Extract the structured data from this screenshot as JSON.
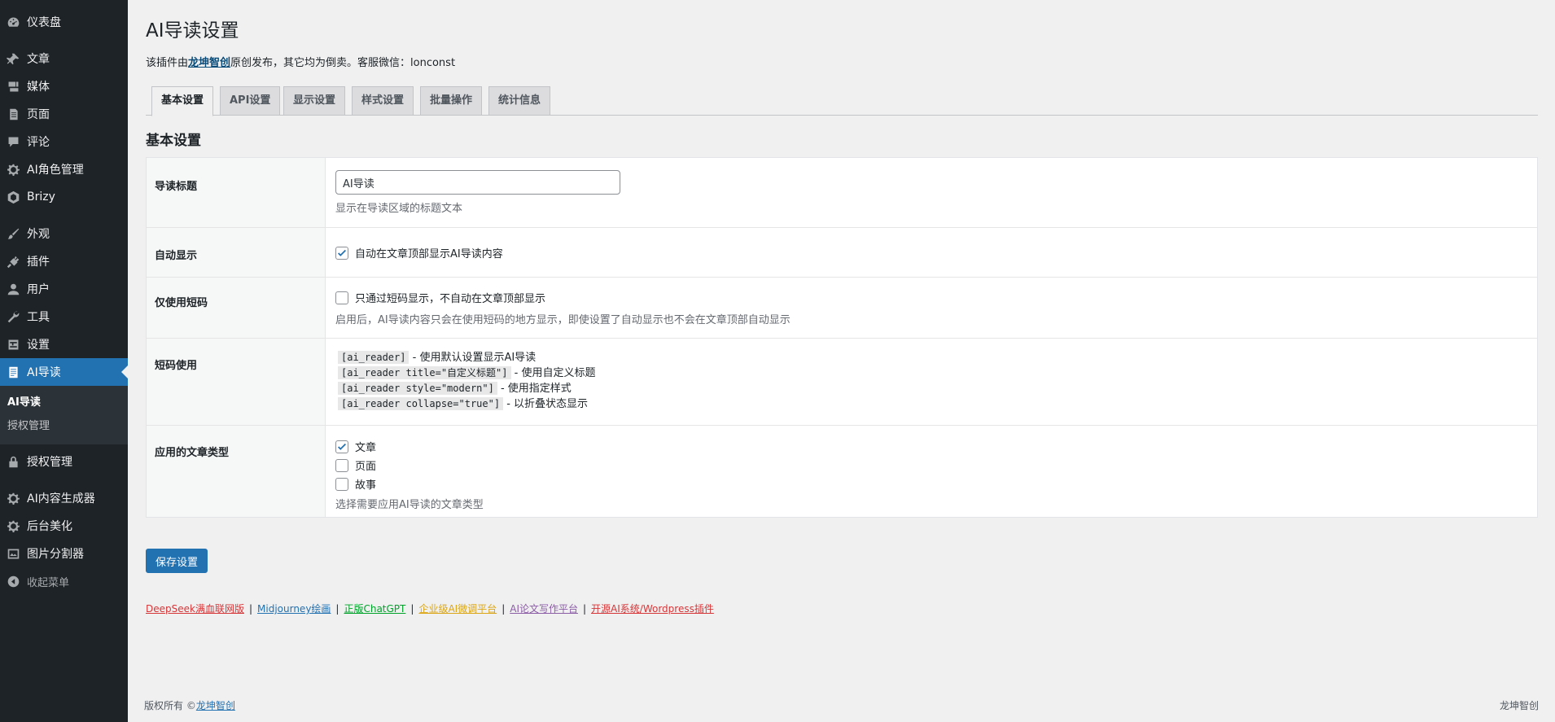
{
  "sidebar": {
    "items": [
      {
        "label": "仪表盘",
        "icon": "dashboard-icon"
      },
      {
        "label": "文章",
        "icon": "pushpin-icon"
      },
      {
        "label": "媒体",
        "icon": "media-icon"
      },
      {
        "label": "页面",
        "icon": "page-icon"
      },
      {
        "label": "评论",
        "icon": "comment-icon"
      },
      {
        "label": "AI角色管理",
        "icon": "gear-icon"
      },
      {
        "label": "Brizy",
        "icon": "brizy-icon"
      },
      {
        "label": "外观",
        "icon": "brush-icon"
      },
      {
        "label": "插件",
        "icon": "plugin-icon"
      },
      {
        "label": "用户",
        "icon": "user-icon"
      },
      {
        "label": "工具",
        "icon": "wrench-icon"
      },
      {
        "label": "设置",
        "icon": "settings-icon"
      },
      {
        "label": "AI导读",
        "icon": "document-icon"
      }
    ],
    "submenu": [
      {
        "label": "AI导读"
      },
      {
        "label": "授权管理"
      }
    ],
    "items2": [
      {
        "label": "授权管理",
        "icon": "lock-icon"
      },
      {
        "label": "AI内容生成器",
        "icon": "gear-icon"
      },
      {
        "label": "后台美化",
        "icon": "gear-icon"
      },
      {
        "label": "图片分割器",
        "icon": "image-icon"
      },
      {
        "label": "收起菜单",
        "icon": "collapse-icon"
      }
    ]
  },
  "page": {
    "title": "AI导读设置",
    "notice_prefix": "该插件由",
    "notice_link": "龙坤智创",
    "notice_suffix": "原创发布，其它均为倒卖。客服微信：lonconst"
  },
  "tabs": [
    {
      "label": "基本设置",
      "active": true
    },
    {
      "label": "API设置",
      "active": false
    },
    {
      "label": "显示设置",
      "active": false
    },
    {
      "label": "样式设置",
      "active": false
    },
    {
      "label": "批量操作",
      "active": false
    },
    {
      "label": "统计信息",
      "active": false
    }
  ],
  "section_title": "基本设置",
  "form": {
    "title_row": {
      "label": "导读标题",
      "value": "AI导读",
      "desc": "显示在导读区域的标题文本"
    },
    "auto_row": {
      "label": "自动显示",
      "checkbox_label": "自动在文章顶部显示AI导读内容",
      "checked": true
    },
    "shortcode_only_row": {
      "label": "仅使用短码",
      "checkbox_label": "只通过短码显示，不自动在文章顶部显示",
      "checked": false,
      "desc": "启用后，AI导读内容只会在使用短码的地方显示，即使设置了自动显示也不会在文章顶部自动显示"
    },
    "shortcode_usage_row": {
      "label": "短码使用",
      "lines": [
        {
          "code": "[ai_reader]",
          "text": " - 使用默认设置显示AI导读"
        },
        {
          "code": "[ai_reader title=\"自定义标题\"]",
          "text": " - 使用自定义标题"
        },
        {
          "code": "[ai_reader style=\"modern\"]",
          "text": " - 使用指定样式"
        },
        {
          "code": "[ai_reader collapse=\"true\"]",
          "text": " - 以折叠状态显示"
        }
      ]
    },
    "post_types_row": {
      "label": "应用的文章类型",
      "options": [
        {
          "label": "文章",
          "checked": true
        },
        {
          "label": "页面",
          "checked": false
        },
        {
          "label": "故事",
          "checked": false
        }
      ],
      "desc": "选择需要应用AI导读的文章类型"
    }
  },
  "save_button": "保存设置",
  "links": [
    {
      "label": "DeepSeek满血联网版",
      "color": "#d63638"
    },
    {
      "label": "Midjourney绘画",
      "color": "#2271b1"
    },
    {
      "label": "正版ChatGPT",
      "color": "#00a32a"
    },
    {
      "label": "企业级AI微调平台",
      "color": "#dba617"
    },
    {
      "label": "AI论文写作平台",
      "color": "#8c5ea6"
    },
    {
      "label": "开源AI系统/Wordpress插件",
      "color": "#d63638"
    }
  ],
  "link_separator": "|",
  "footer": {
    "prefix": "版权所有 ©",
    "link": "龙坤智创",
    "right": "龙坤智创"
  },
  "colors": {
    "accent": "#2271b1",
    "sidebar_bg": "#1d2327"
  }
}
